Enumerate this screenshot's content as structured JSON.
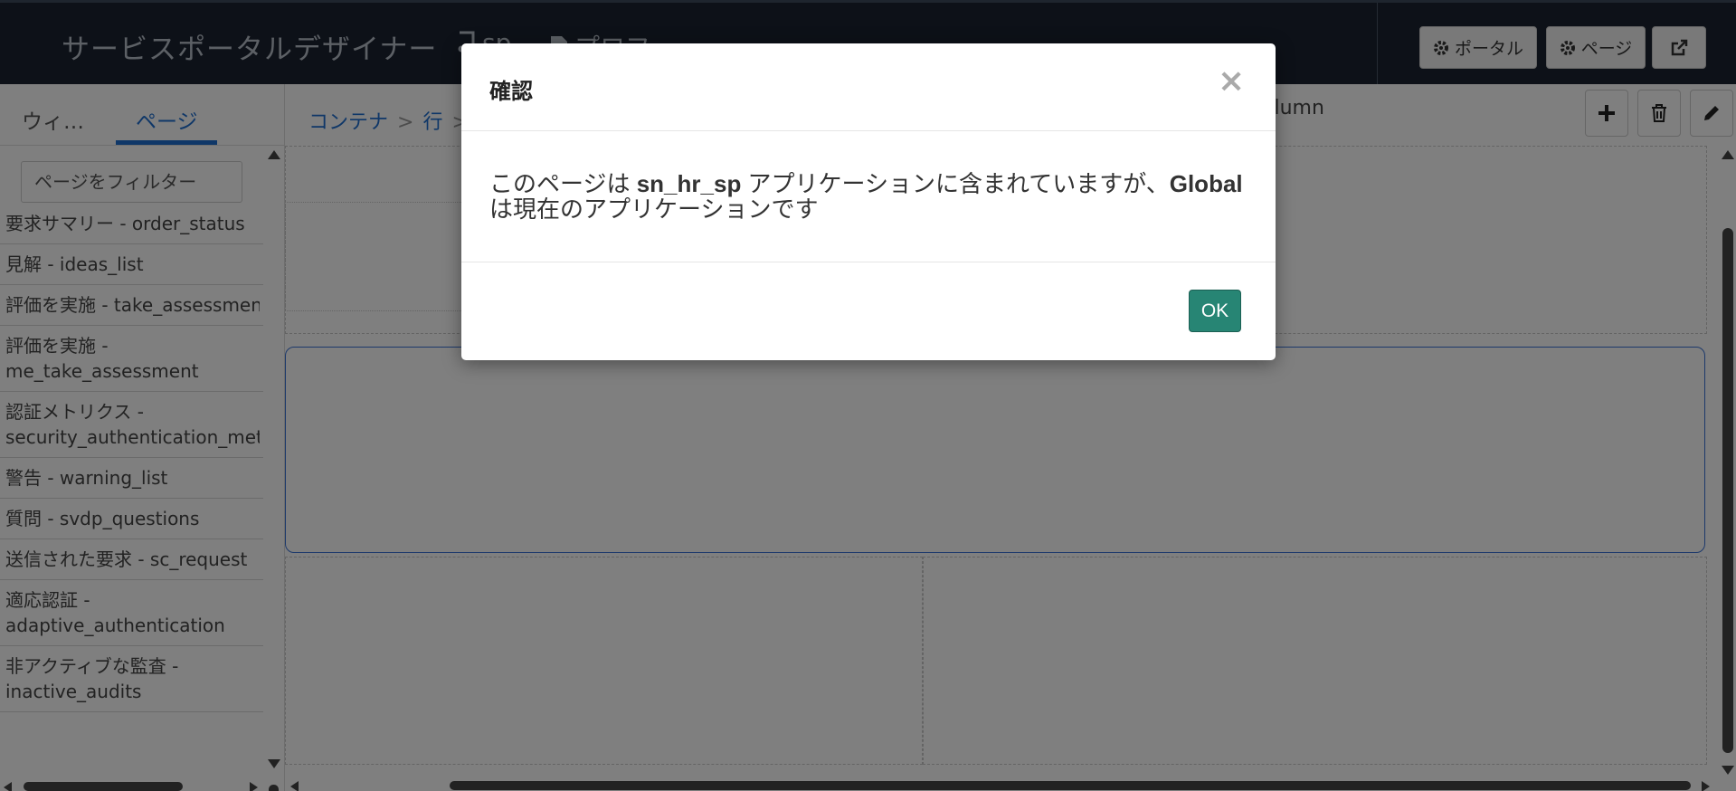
{
  "header": {
    "app_title": "サービスポータルデザイナー",
    "portal_crumb": "sp",
    "page_crumb": "プロフ...",
    "portal_button": "ポータル",
    "page_button": "ページ"
  },
  "sidebar": {
    "tabs": [
      "ウィ…",
      "ページ"
    ],
    "filter_placeholder": "ページをフィルター",
    "pages": [
      {
        "label": "要求サマリー - order_status"
      },
      {
        "label": "見解 - ideas_list"
      },
      {
        "label": "評価を実施 - take_assessment"
      },
      {
        "label": "評価を実施 -",
        "label2": "me_take_assessment"
      },
      {
        "label": "認証メトリクス -",
        "label2": "security_authentication_metric"
      },
      {
        "label": "警告 - warning_list"
      },
      {
        "label": "質問 - svdp_questions"
      },
      {
        "label": "送信された要求 - sc_request"
      },
      {
        "label": "適応認証 -",
        "label2": "adaptive_authentication"
      },
      {
        "label": "非アクティブな監査 -",
        "label2": "inactive_audits"
      }
    ]
  },
  "main": {
    "breadcrumb": [
      "コンテナ",
      "行"
    ],
    "column_label": "olumn"
  },
  "modal": {
    "title": "確認",
    "close": "×",
    "body_part1": "このページは ",
    "body_app": "sn_hr_sp",
    "body_part2": " アプリケーションに含まれていますが、",
    "body_current": "Global",
    "body_part3": "は現在のアプリケーションです",
    "ok": "OK"
  },
  "colors": {
    "header_bg": "#1b2331",
    "accent": "#1f6fd0",
    "ok_button": "#278574"
  }
}
